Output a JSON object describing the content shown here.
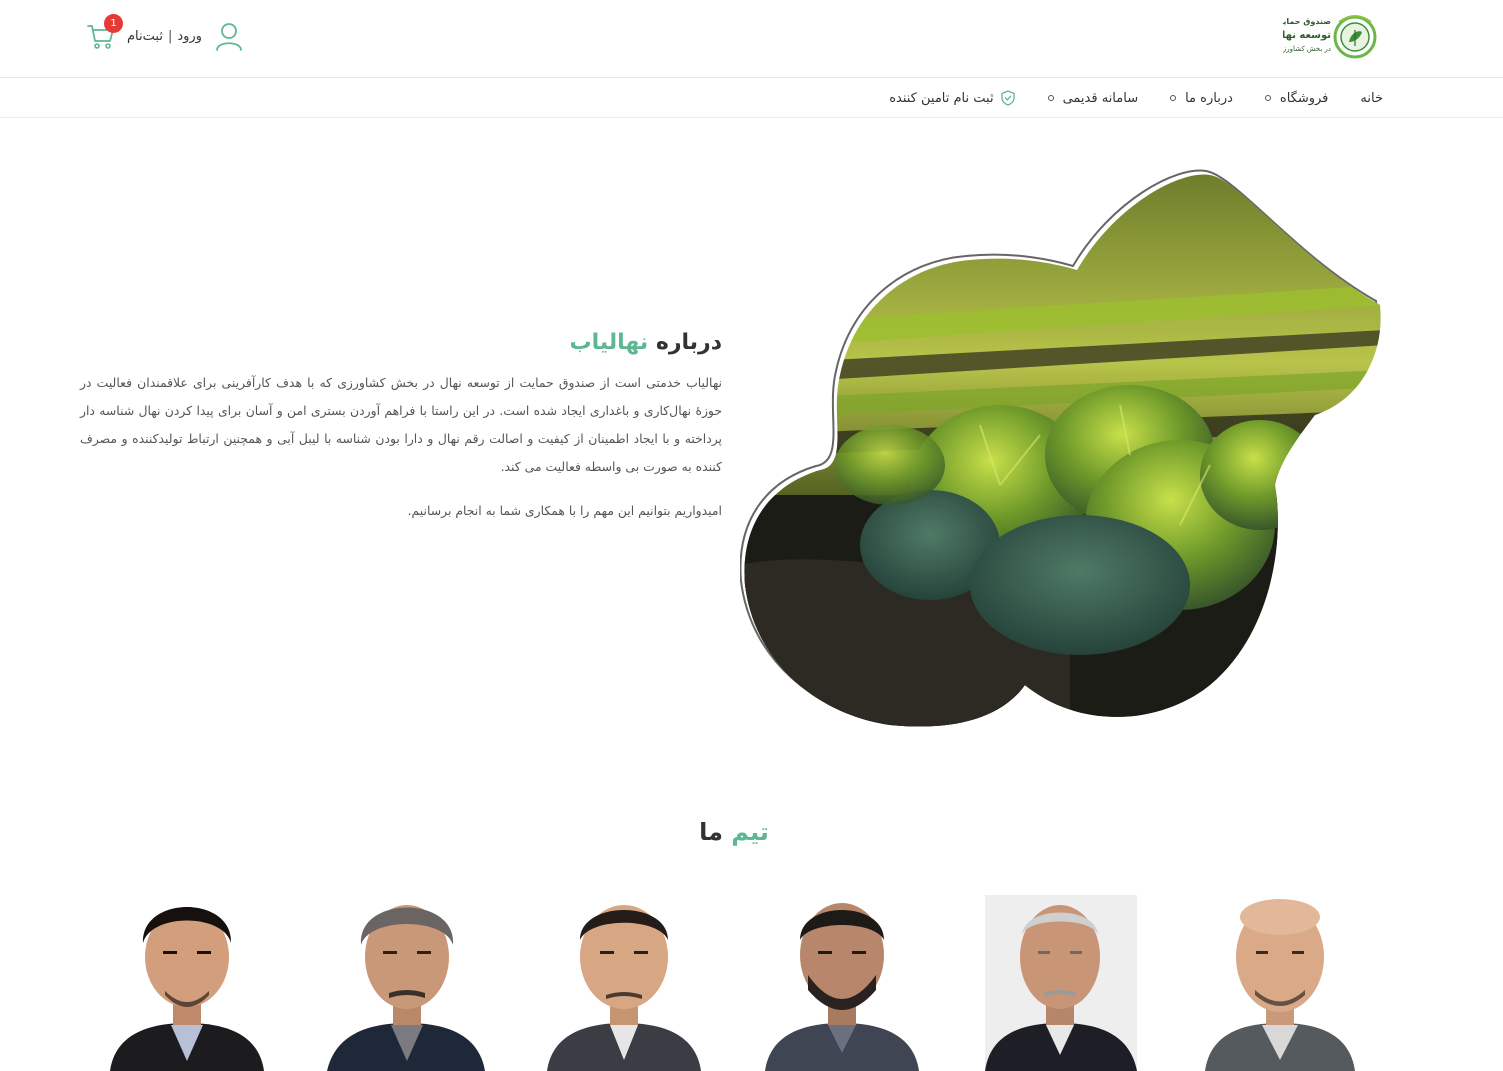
{
  "header": {
    "logo_text": [
      "صندوق حمایت از",
      "توسعه نهال",
      "در بخش کشاورزی"
    ],
    "login_label": "ورود",
    "register_label": "ثبت‌نام",
    "separator": "|",
    "cart_count": "1"
  },
  "nav": {
    "items": [
      {
        "label": "خانه"
      },
      {
        "label": "فروشگاه"
      },
      {
        "label": "درباره ما"
      },
      {
        "label": "سامانه قدیمی"
      },
      {
        "label": "ثبت نام تامین کننده"
      }
    ]
  },
  "about": {
    "title_prefix": "درباره",
    "title_accent": "نهالیاب",
    "paragraph1": "نهالیاب خدمتی است از صندوق حمایت از توسعه نهال در بخش کشاورزی که با هدف کارآفرینی برای علاقمندان فعالیت در حوزهٔ نهال‌کاری و باغداری ایجاد شده است. در این راستا با فراهم آوردن بستری امن و آسان برای پیدا کردن نهال شناسه دار پرداخته و با ایجاد اطمینان از کیفیت و اصالت رقم نهال و دارا بودن شناسه با لیبل آبی و همچنین ارتباط تولیدکننده و مصرف کننده به صورت بی واسطه فعالیت می کند.",
    "paragraph2": "امیدواریم بتوانیم این مهم را با همکاری شما به انجام برسانیم."
  },
  "team": {
    "title_prefix": "تیم",
    "title_accent": "ما",
    "members_count": 6
  },
  "colors": {
    "accent": "#5cb890",
    "badge": "#e53935",
    "text": "#333333"
  }
}
